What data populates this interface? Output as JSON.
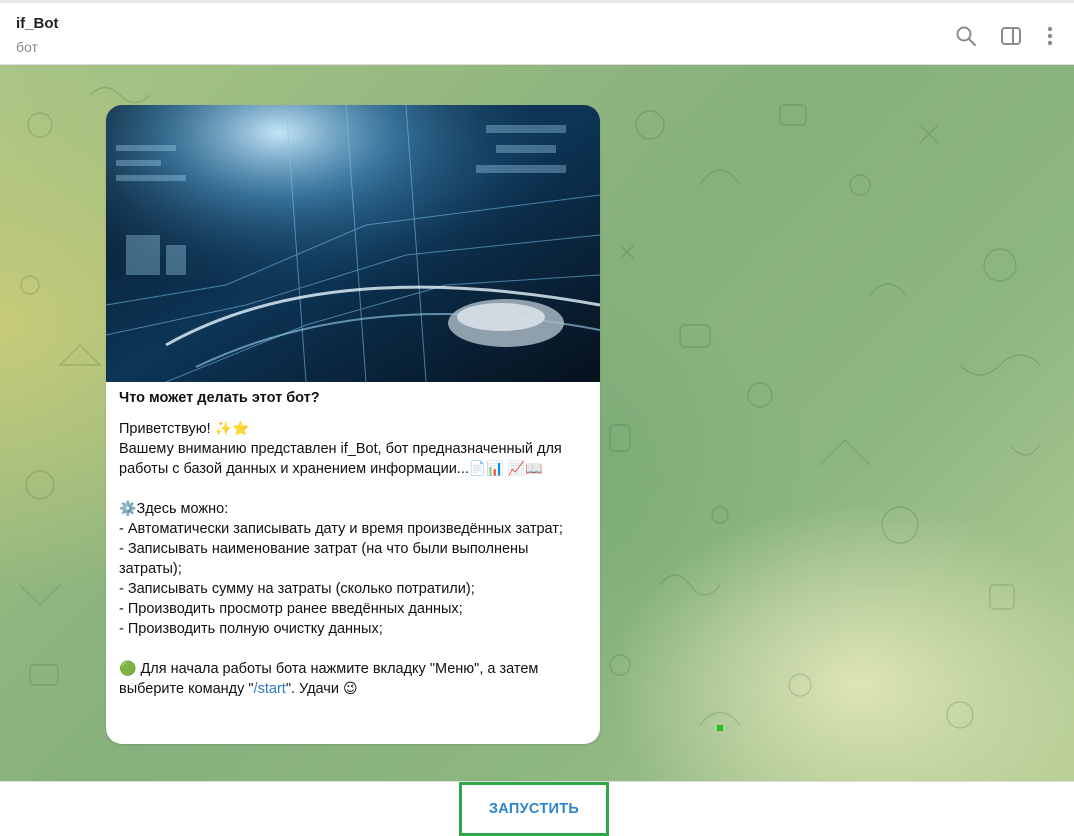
{
  "header": {
    "title": "if_Bot",
    "subtitle": "бот",
    "icons": [
      "search-icon",
      "sidebar-toggle-icon",
      "more-vertical-icon"
    ]
  },
  "message": {
    "image": "futuristic-computer-mouse-banner",
    "heading": "Что может делать этот бот?",
    "greeting": "Приветствую!",
    "greeting_emoji": "✨⭐",
    "intro": "Вашему вниманию представлен if_Bot, бот предназначенный для работы с базой данных и хранением информации...",
    "intro_emoji_1": "📄📊",
    "intro_emoji_2": "📈📖",
    "features_icon": "⚙️",
    "features_title": "Здесь можно:",
    "features": [
      "- Автоматически записывать дату и время произведённых затрат;",
      "- Записывать наименование затрат (на что были выполнены затраты);",
      "- Записывать сумму на затраты (сколько потратили);",
      "- Производить просмотр ранее введённых данных;",
      "- Производить полную очистку данных;"
    ],
    "cta_icon": "🟢",
    "cta_text_before": "Для начала работы бота нажмите вкладку \"Меню\", а затем выберите команду \"",
    "cta_link": "/start",
    "cta_text_after": "\". Удачи",
    "cta_emoji": "😉"
  },
  "footer": {
    "start_label": "ЗАПУСТИТЬ"
  },
  "colors": {
    "accent_link": "#2a7bc0",
    "start_button_text": "#2a86d0",
    "highlight_border": "#2fa84a"
  }
}
